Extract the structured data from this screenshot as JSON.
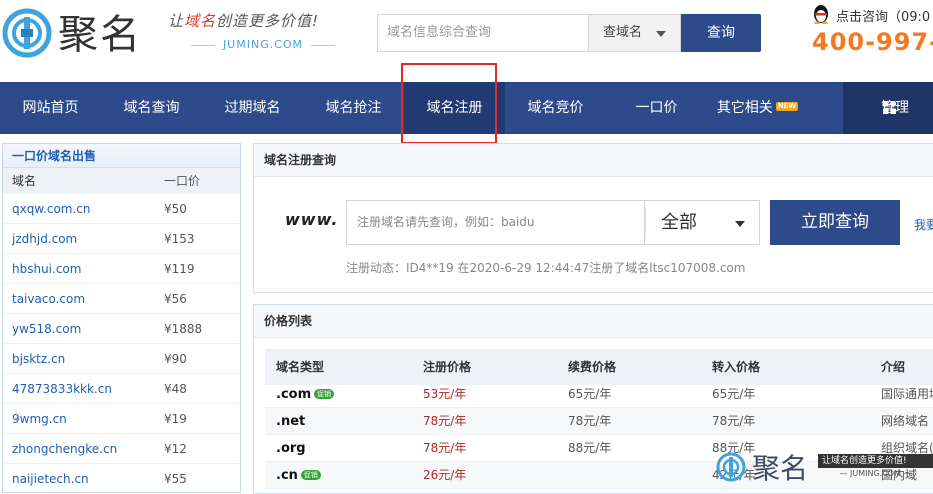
{
  "header": {
    "logo_text": "聚名",
    "slogan_prefix": "让",
    "slogan_highlight": "域名",
    "slogan_suffix": "创造更多价值!",
    "slogan_url": "JUMING.COM",
    "search_placeholder": "域名信息综合查询",
    "search_type": "查域名",
    "search_button": "查询",
    "consult": "点击咨询（09:0",
    "hotline": "400-997-"
  },
  "nav": {
    "items": [
      {
        "label": "网站首页"
      },
      {
        "label": "域名查询"
      },
      {
        "label": "过期域名"
      },
      {
        "label": "域名抢注"
      },
      {
        "label": "域名注册"
      },
      {
        "label": "域名竞价"
      },
      {
        "label": "一口价"
      },
      {
        "label": "其它相关",
        "badge": "NEW"
      }
    ],
    "active": "域名注册",
    "admin_label": "管理"
  },
  "sidebar": {
    "title": "一口价域名出售",
    "col_domain": "域名",
    "col_price": "一口价",
    "rows": [
      {
        "domain": "qxqw.com.cn",
        "price": "¥50"
      },
      {
        "domain": "jzdhjd.com",
        "price": "¥153"
      },
      {
        "domain": "hbshui.com",
        "price": "¥119"
      },
      {
        "domain": "taivaco.com",
        "price": "¥56"
      },
      {
        "domain": "yw518.com",
        "price": "¥1888"
      },
      {
        "domain": "bjsktz.cn",
        "price": "¥90"
      },
      {
        "domain": "47873833kkk.cn",
        "price": "¥48"
      },
      {
        "domain": "9wmg.cn",
        "price": "¥19"
      },
      {
        "domain": "zhongchengke.cn",
        "price": "¥12"
      },
      {
        "domain": "naijietech.cn",
        "price": "¥55"
      }
    ]
  },
  "register": {
    "title": "域名注册查询",
    "www": "www.",
    "placeholder": "注册域名请先查询，例如：baidu",
    "type": "全部",
    "button": "立即查询",
    "side_link": "我要",
    "news": "注册动态：ID4**19 在2020-6-29 12:44:47注册了域名ltsc107008.com"
  },
  "price_list": {
    "title": "价格列表",
    "headers": [
      "域名类型",
      "注册价格",
      "续费价格",
      "转入价格",
      "介绍"
    ],
    "rows": [
      {
        "tld": ".com",
        "promo": "促销",
        "reg": "53元/年",
        "renew": "65元/年",
        "transfer": "65元/年",
        "intro": "国际通用域"
      },
      {
        "tld": ".net",
        "promo": "",
        "reg": "78元/年",
        "renew": "78元/年",
        "transfer": "78元/年",
        "intro": "网络域名"
      },
      {
        "tld": ".org",
        "promo": "",
        "reg": "78元/年",
        "renew": "88元/年",
        "transfer": "88元/年",
        "intro": "组织域名(暂不"
      },
      {
        "tld": ".cn",
        "promo": "促销",
        "reg": "26元/年",
        "renew": "",
        "transfer": "42元/年",
        "intro": "国内域"
      }
    ]
  },
  "watermark": {
    "name": "聚名",
    "tagline": "让域名创造更多价值!",
    "url": "— JUMING.COM —"
  },
  "colors": {
    "nav_bg": "#2d4a8a",
    "nav_active_bg": "#223a72",
    "hotline": "#f47820",
    "price_red": "#b0281e",
    "link_blue": "#1f5fae",
    "highlight_box": "#e02b2b"
  }
}
